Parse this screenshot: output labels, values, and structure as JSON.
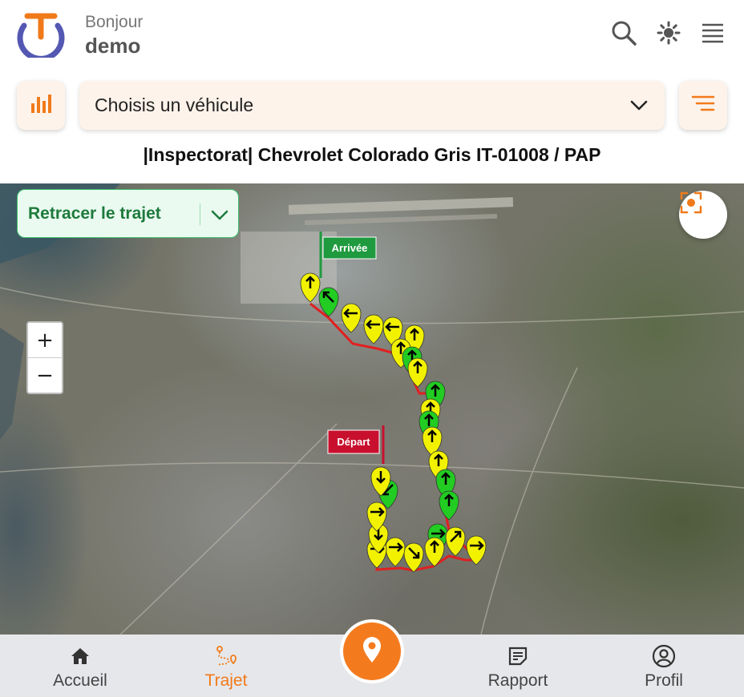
{
  "header": {
    "greeting": "Bonjour",
    "username": "demo",
    "icons": [
      "search-icon",
      "brightness-icon",
      "menu-icon"
    ]
  },
  "toolbar": {
    "vehicle_select_value": "Choisis un véhicule",
    "stats_icon": "bar-chart-icon",
    "filter_icon": "filter-icon"
  },
  "vehicle_title": "|Inspectorat| Chevrolet Colorado Gris IT-01008 / PAP",
  "map": {
    "retrace_label": "Retracer le trajet",
    "zoom_in": "+",
    "zoom_out": "−",
    "start_label": "Départ",
    "end_label": "Arrivée",
    "colors": {
      "route": "#e02020",
      "marker_yellow": "#f2f200",
      "marker_green": "#22cc22",
      "start_flag": "#c8102e",
      "end_flag": "#1f9a3f"
    }
  },
  "bottom_nav": {
    "items": [
      {
        "label": "Accueil",
        "icon": "home-icon"
      },
      {
        "label": "Trajet",
        "icon": "route-icon"
      },
      {
        "label": "Rapport",
        "icon": "report-icon"
      },
      {
        "label": "Profil",
        "icon": "profile-icon"
      }
    ],
    "active": "Trajet",
    "fab_icon": "location-pin-icon",
    "accent": "#f47b1d"
  }
}
